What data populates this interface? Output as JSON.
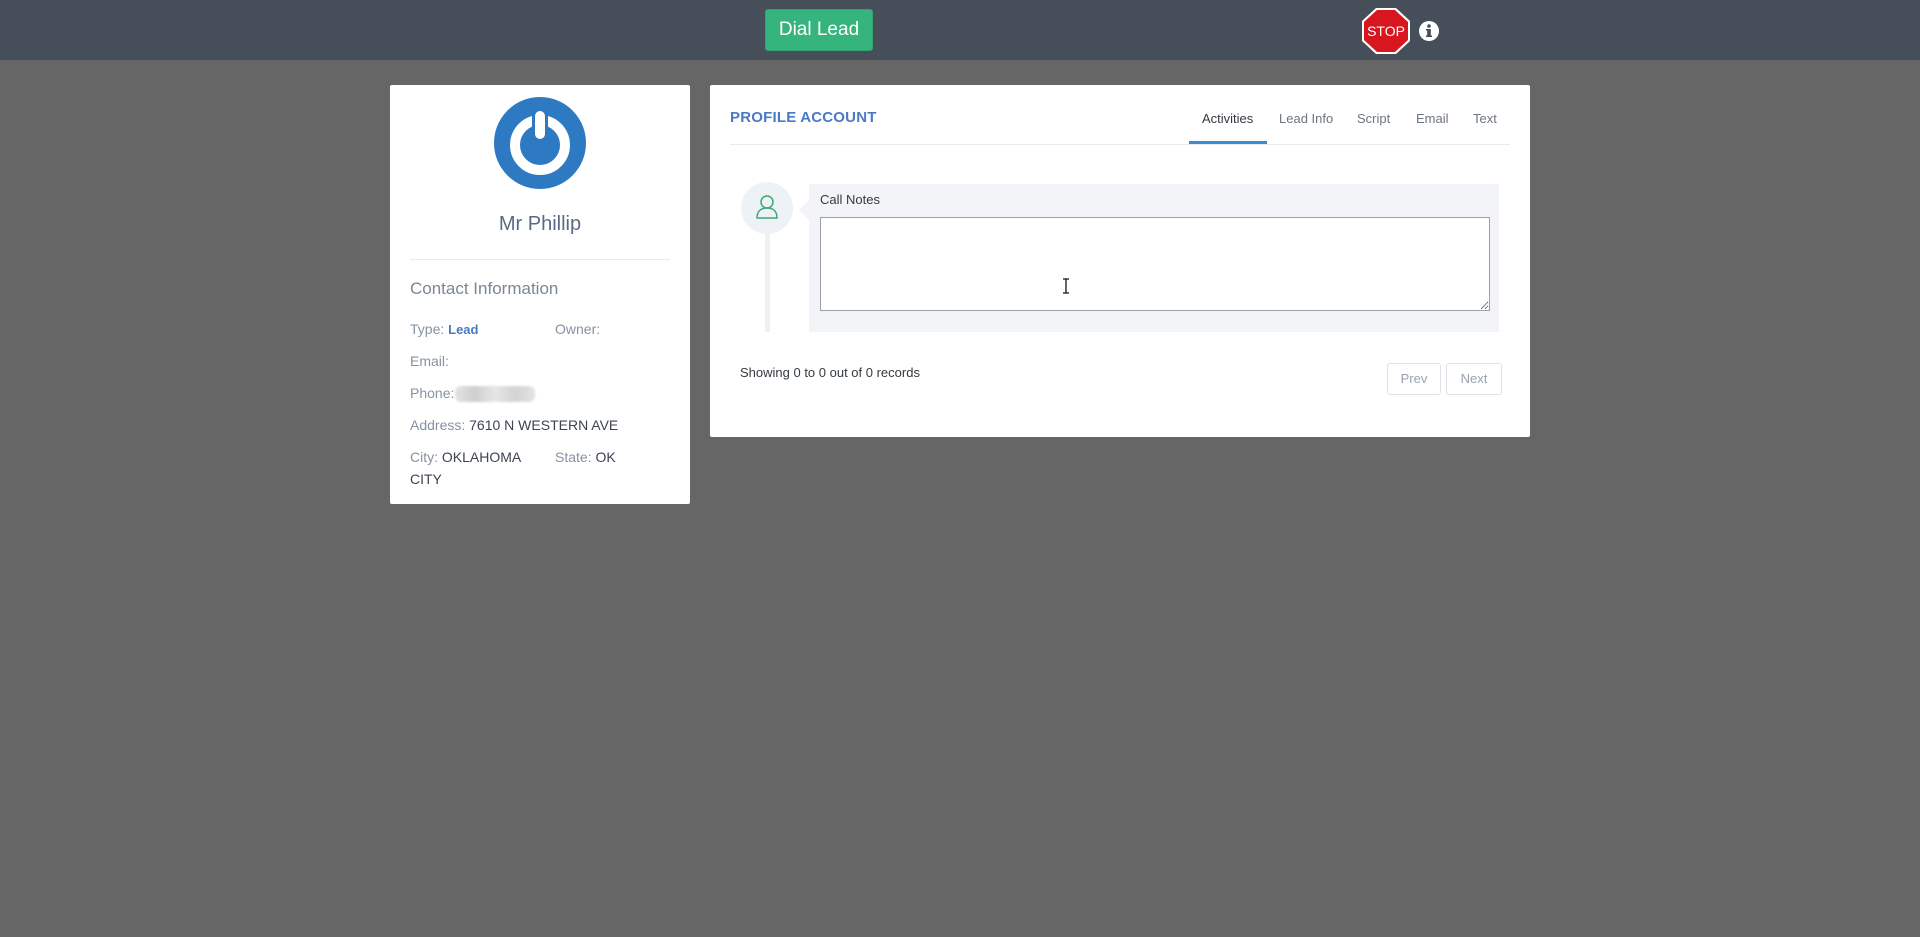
{
  "topbar": {
    "dial_label": "Dial Lead",
    "stop_label": "STOP",
    "colors": {
      "background": "#464e59",
      "dial": "#36b47e",
      "stop": "#d7161f"
    }
  },
  "profile": {
    "name": "Mr Phillip",
    "avatar_icon": "power-icon",
    "avatar_color": "#2d79c2",
    "contact_title": "Contact Information",
    "type_label": "Type:",
    "type_value": "Lead",
    "owner_label": "Owner:",
    "owner_value": "",
    "email_label": "Email:",
    "email_value": "",
    "phone_label": "Phone:",
    "address_label": "Address:",
    "address_value": "7610 N WESTERN AVE",
    "city_label": "City:",
    "city_value": "OKLAHOMA CITY",
    "state_label": "State:",
    "state_value": "OK"
  },
  "main": {
    "title": "PROFILE ACCOUNT",
    "tabs": [
      {
        "label": "Activities",
        "active": true
      },
      {
        "label": "Lead Info",
        "active": false
      },
      {
        "label": "Script",
        "active": false
      },
      {
        "label": "Email",
        "active": false
      },
      {
        "label": "Text",
        "active": false
      }
    ],
    "notes_label": "Call Notes",
    "notes_value": "",
    "records_text": "Showing 0 to 0 out of 0 records",
    "prev_label": "Prev",
    "next_label": "Next"
  }
}
